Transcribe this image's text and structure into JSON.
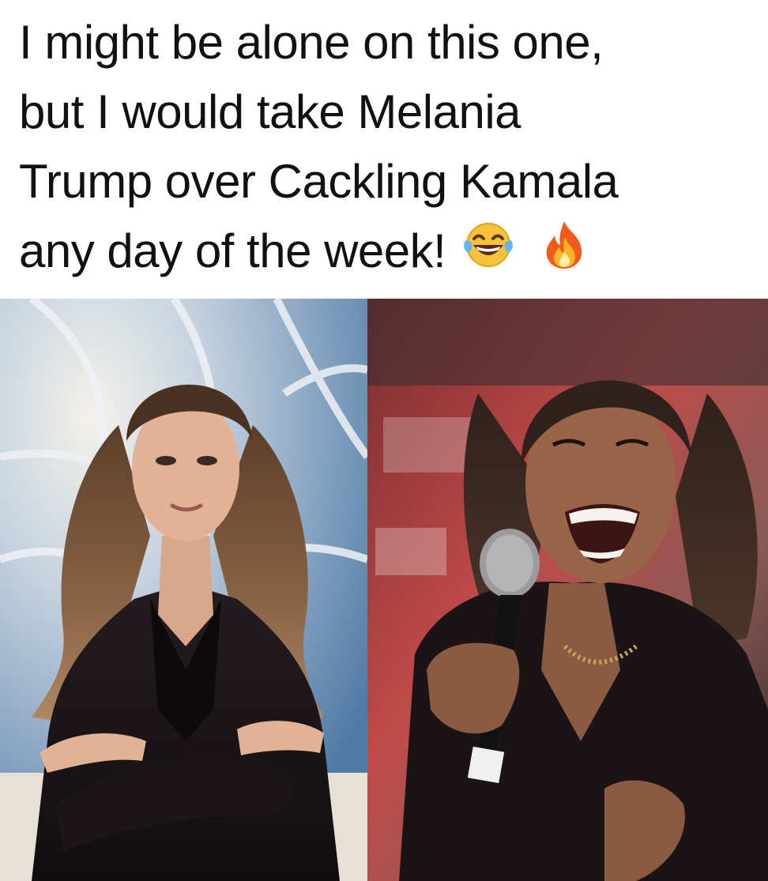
{
  "caption": {
    "line1": "I might be alone on this one,",
    "line2": "but I would take Melania",
    "line3": "Trump over Cackling Kamala",
    "line4": "any day of the week!",
    "emoji": [
      "laughing-tears-emoji",
      "fire-emoji"
    ]
  },
  "photos": [
    {
      "subject": "Melania Trump",
      "pose": "arms crossed, black suit",
      "background": "window"
    },
    {
      "subject": "Kamala Harris",
      "pose": "laughing holding microphone, black suit",
      "background": "blurred red"
    }
  ],
  "colors": {
    "text": "#111111",
    "background": "#ffffff",
    "suit": "#1a1416",
    "left_backdrop": "#5f86ad",
    "right_backdrop": "#b43a3c"
  }
}
